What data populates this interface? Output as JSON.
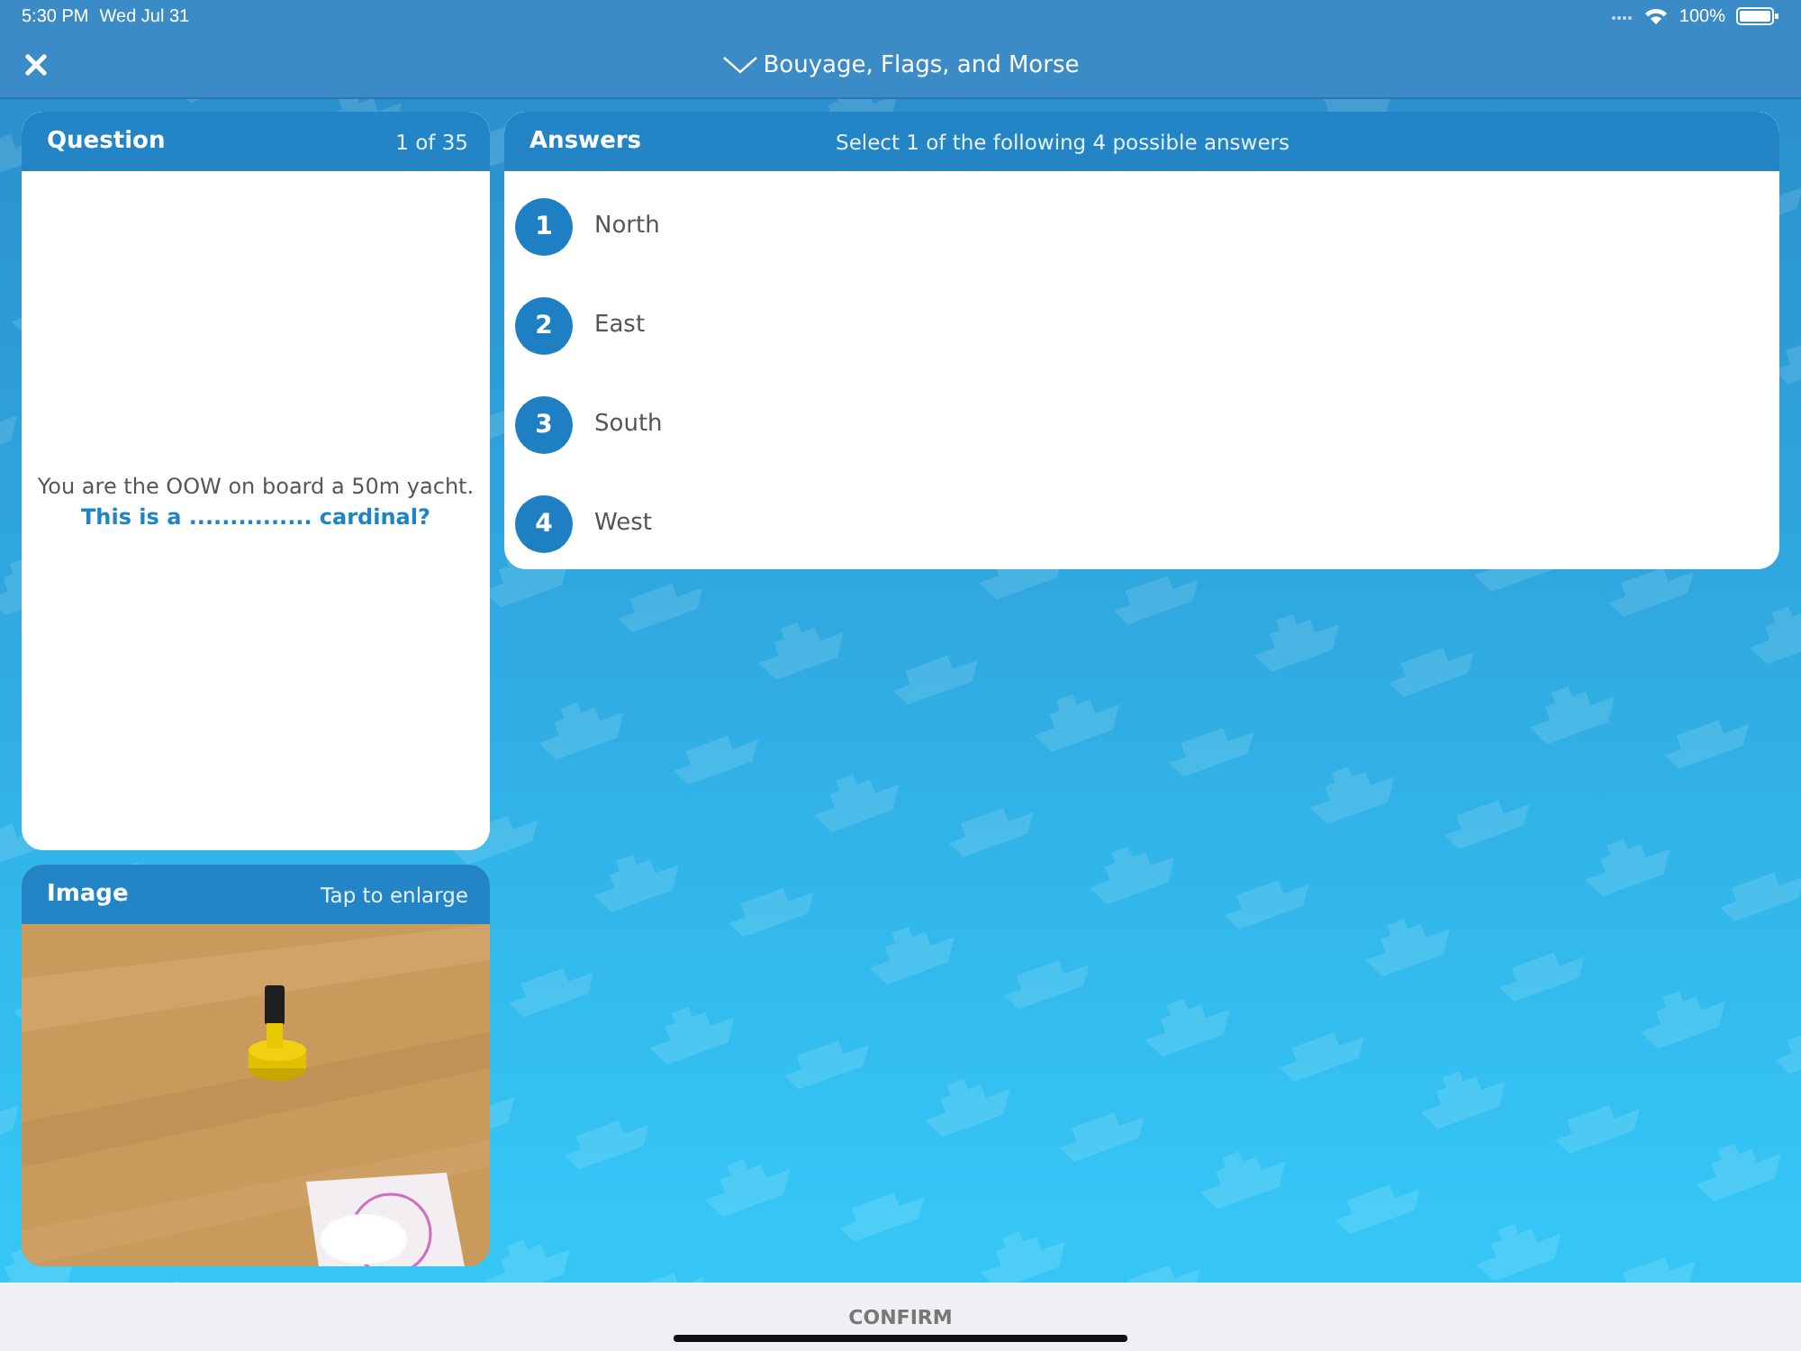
{
  "status_bar": {
    "time": "5:30 PM",
    "date": "Wed Jul 31",
    "battery": "100%"
  },
  "header": {
    "title": "Bouyage, Flags, and Morse"
  },
  "question": {
    "heading": "Question",
    "counter": "1 of 35",
    "text": "You are the OOW on board a 50m yacht.",
    "prompt": "This is a ............... cardinal?"
  },
  "image": {
    "heading": "Image",
    "hint": "Tap to enlarge",
    "kind": "picture"
  },
  "answers": {
    "heading": "Answers",
    "instruction": "Select 1 of the following 4 possible answers",
    "options": [
      {
        "number": "1",
        "label": "North",
        "selected": false
      },
      {
        "number": "2",
        "label": "East",
        "selected": false
      },
      {
        "number": "3",
        "label": "South",
        "selected": false
      },
      {
        "number": "4",
        "label": "West",
        "selected": false
      }
    ]
  },
  "footer": {
    "button": "CONFIRM"
  }
}
